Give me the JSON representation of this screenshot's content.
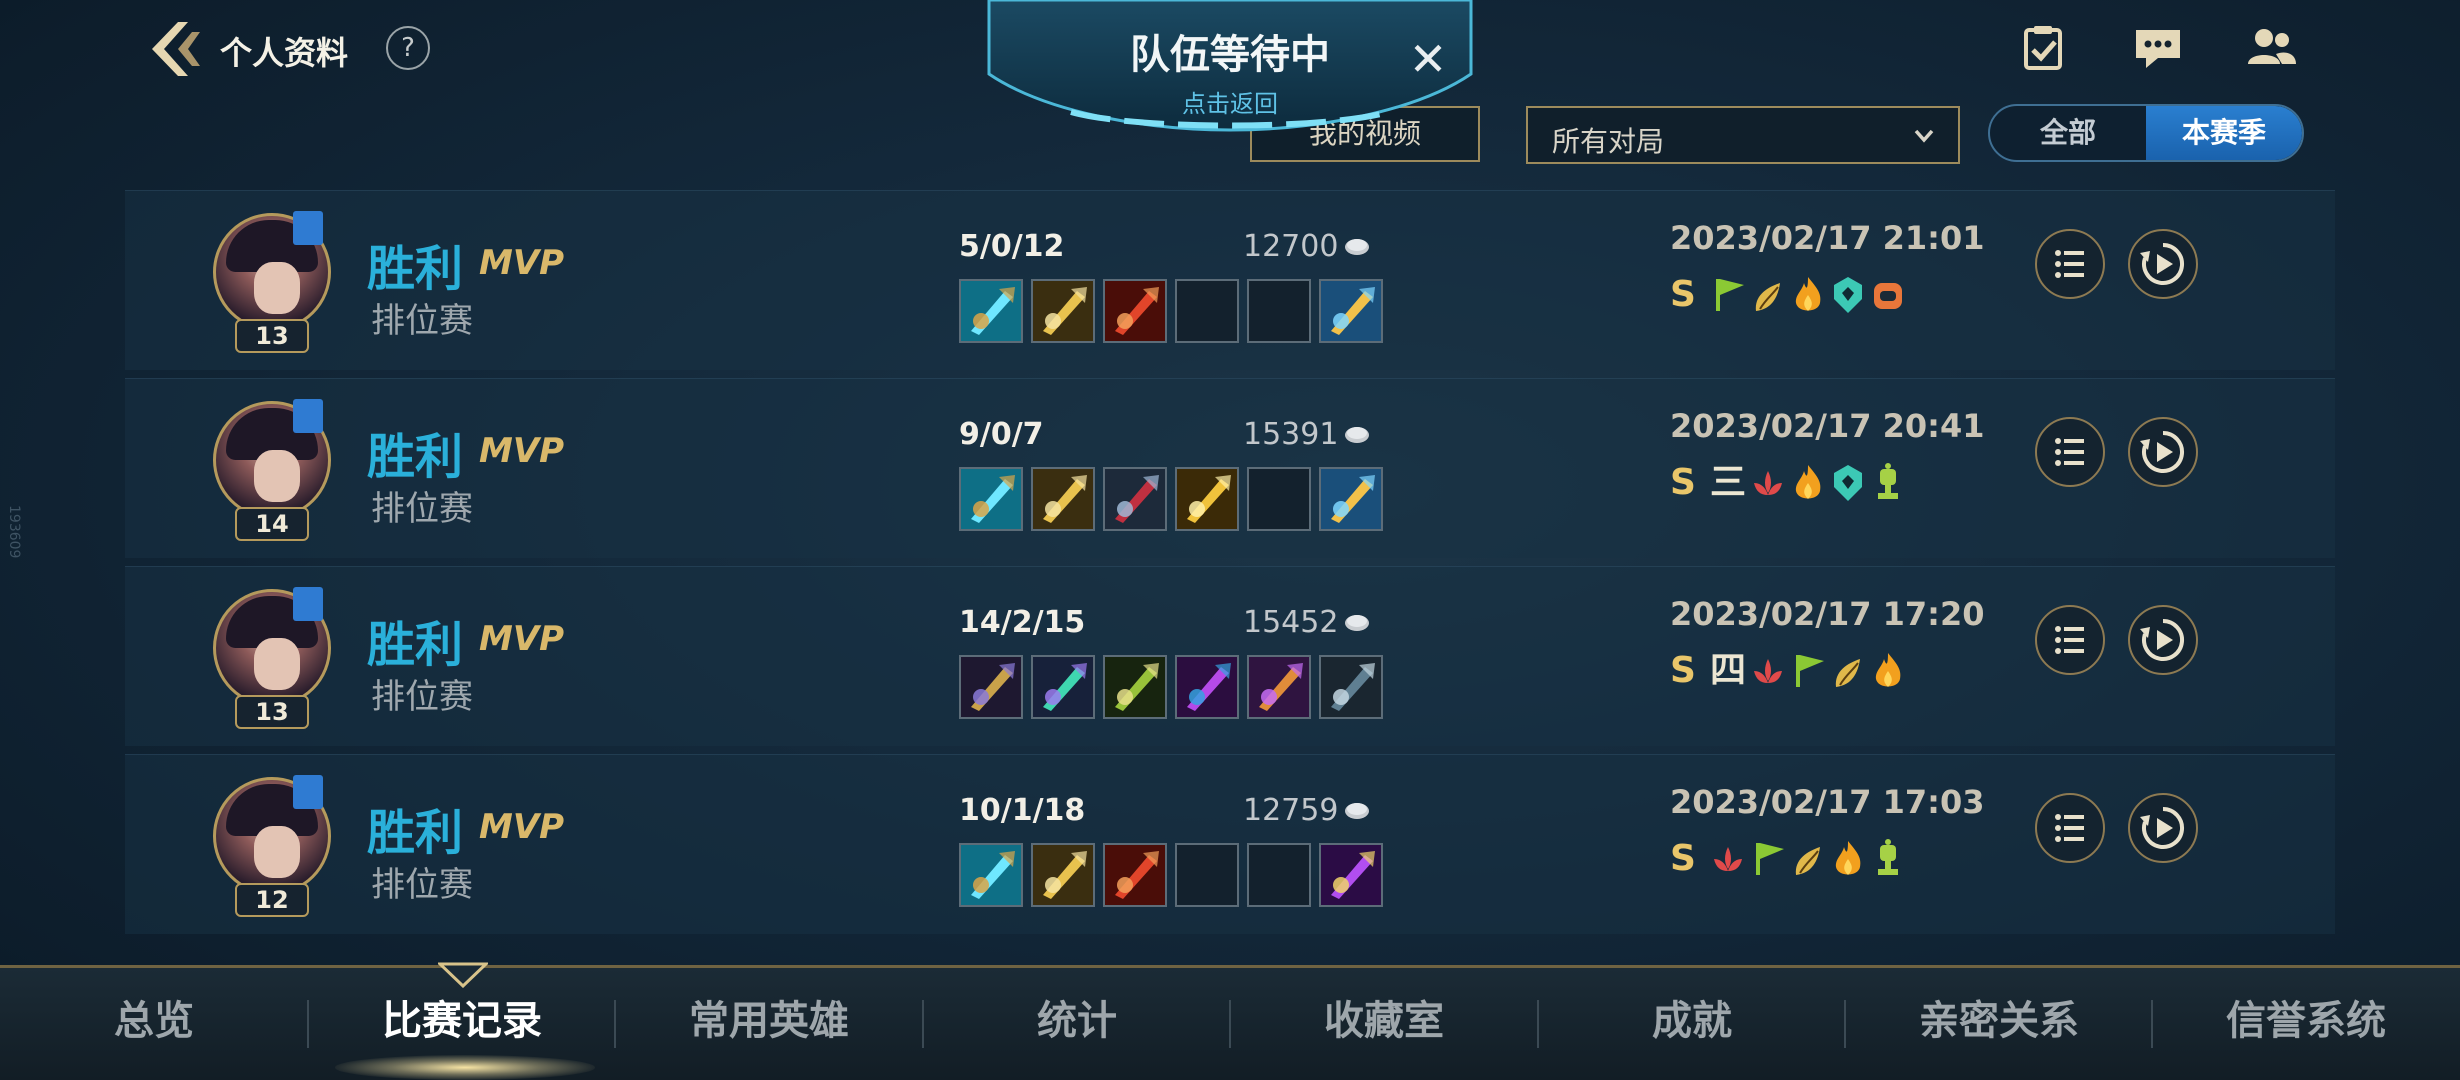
{
  "header": {
    "title": "个人资料",
    "help": "?",
    "side_tag": "193609"
  },
  "queue": {
    "title": "队伍等待中",
    "subtitle": "点击返回",
    "close": "✕"
  },
  "filters": {
    "video_button": "我的视频",
    "mode_select": "所有对局",
    "toggle_all": "全部",
    "toggle_season": "本赛季"
  },
  "matches": [
    {
      "result": "胜利",
      "mvp": "MVP",
      "mode": "排位赛",
      "level": "13",
      "kda": "5/0/12",
      "gold": "12700",
      "time": "2023/02/17 21:01",
      "items": [
        "cyan-sword",
        "gold-blade",
        "red-blade",
        "empty",
        "empty",
        "gold-trinket"
      ],
      "honors": [
        "S",
        "flag",
        "flame-leaf",
        "fire",
        "shield",
        "chain"
      ]
    },
    {
      "result": "胜利",
      "mvp": "MVP",
      "mode": "排位赛",
      "level": "14",
      "kda": "9/0/7",
      "gold": "15391",
      "time": "2023/02/17 20:41",
      "items": [
        "cyan-sword",
        "gold-blade",
        "crimson-spikes",
        "gold-cross",
        "empty",
        "gold-trinket"
      ],
      "honors": [
        "S",
        "三",
        "red-lotus",
        "fire",
        "shield",
        "trophy"
      ]
    },
    {
      "result": "胜利",
      "mvp": "MVP",
      "mode": "排位赛",
      "level": "13",
      "kda": "14/2/15",
      "gold": "15452",
      "time": "2023/02/17 17:20",
      "items": [
        "dark-shuriken",
        "green-claw",
        "green-sword",
        "purple-scythe",
        "purple-orb",
        "dark-trinket"
      ],
      "honors": [
        "S",
        "四",
        "red-lotus",
        "flag",
        "flame-leaf",
        "fire"
      ]
    },
    {
      "result": "胜利",
      "mvp": "MVP",
      "mode": "排位赛",
      "level": "12",
      "kda": "10/1/18",
      "gold": "12759",
      "time": "2023/02/17 17:03",
      "items": [
        "cyan-sword",
        "gold-blade",
        "red-blade",
        "empty",
        "empty",
        "violet-trinket"
      ],
      "honors": [
        "S",
        "red-lotus",
        "flag",
        "flame-leaf",
        "fire",
        "trophy"
      ]
    }
  ],
  "nav": {
    "tabs": [
      "总览",
      "比赛记录",
      "常用英雄",
      "统计",
      "收藏室",
      "成就",
      "亲密关系",
      "信誉系统"
    ],
    "active": 1
  },
  "colors": {
    "accent_blue": "#2ab0da",
    "mvp_gold": "#d9b86a",
    "border_gold": "#9d8b5c"
  }
}
